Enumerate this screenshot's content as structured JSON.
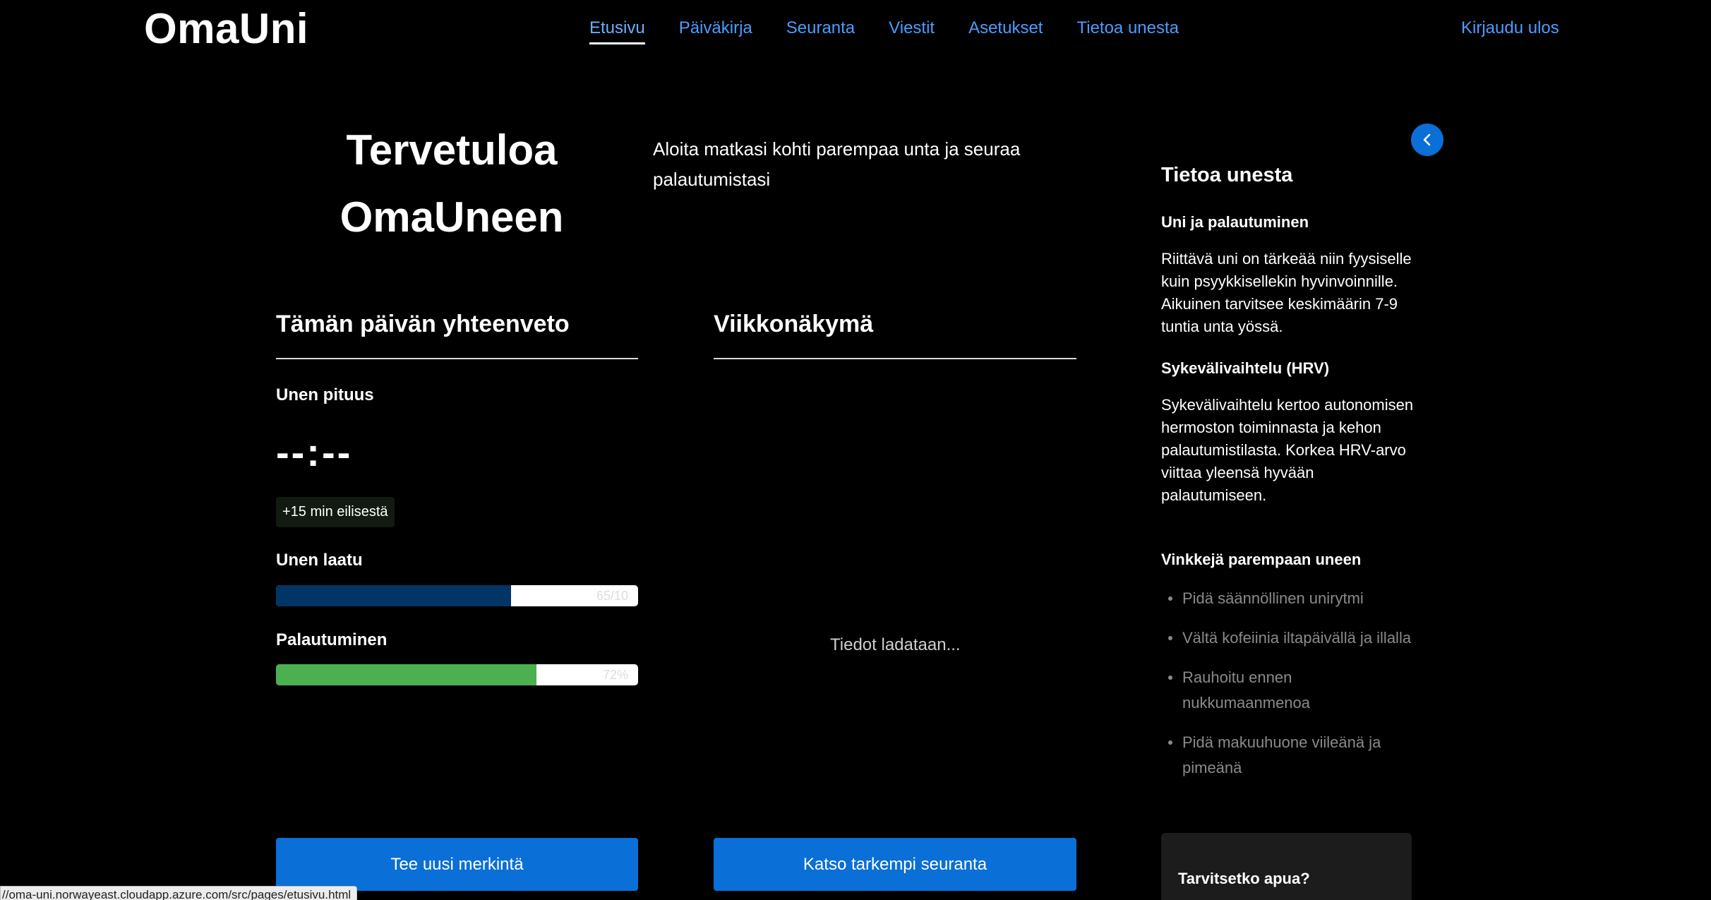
{
  "header": {
    "logo": "OmaUni",
    "nav": [
      {
        "label": "Etusivu",
        "active": true
      },
      {
        "label": "Päiväkirja"
      },
      {
        "label": "Seuranta"
      },
      {
        "label": "Viestit"
      },
      {
        "label": "Asetukset"
      },
      {
        "label": "Tietoa unesta"
      }
    ],
    "logout": "Kirjaudu ulos"
  },
  "hero": {
    "title_line1": "Tervetuloa",
    "title_line2": "OmaUneen",
    "subtitle": "Aloita matkasi kohti parempaa unta ja seuraa palautumistasi"
  },
  "summary": {
    "title": "Tämän päivän yhteenveto",
    "sleep_length_label": "Unen pituus",
    "sleep_length_value": "--:--",
    "change_chip": "+15 min eilisestä",
    "quality_label": "Unen laatu",
    "quality_value_text": "65/10",
    "quality_fraction": 0.65,
    "recovery_label": "Palautuminen",
    "recovery_value_text": "72%",
    "recovery_fraction": 0.72,
    "new_entry_button": "Tee uusi merkintä"
  },
  "weekly": {
    "title": "Viikkonäkymä",
    "loading_text": "Tiedot ladataan...",
    "detailed_button": "Katso tarkempi seuranta"
  },
  "sidebar": {
    "collapse_icon": "chevron-left-icon",
    "title": "Tietoa unesta",
    "section1_title": "Uni ja palautuminen",
    "section1_text": "Riittävä uni on tärkeää niin fyysiselle kuin psyykkisellekin hyvinvoinnille. Aikuinen tarvitsee keskimäärin 7-9 tuntia unta yössä.",
    "section2_title": "Sykevälivaihtelu (HRV)",
    "section2_text": "Sykevälivaihtelu kertoo autonomisen hermoston toiminnasta ja kehon palautumistilasta. Korkea HRV-arvo viittaa yleensä hyvään palautumiseen.",
    "tips_title": "Vinkkejä parempaan uneen",
    "tips": [
      "Pidä säännöllinen unirytmi",
      "Vältä kofeiinia iltapäivällä ja illalla",
      "Rauhoitu ennen nukkumaanmenoa",
      "Pidä makuuhuone viileänä ja pimeänä"
    ],
    "help_title": "Tarvitsetko apua?"
  },
  "status_bar": "//oma-uni.norwayeast.cloudapp.azure.com/src/pages/etusivu.html",
  "colors": {
    "accent": "#0a6fd6",
    "link": "#4d9cff",
    "quality_bar": "#003566",
    "recovery_bar": "#4caf50"
  }
}
